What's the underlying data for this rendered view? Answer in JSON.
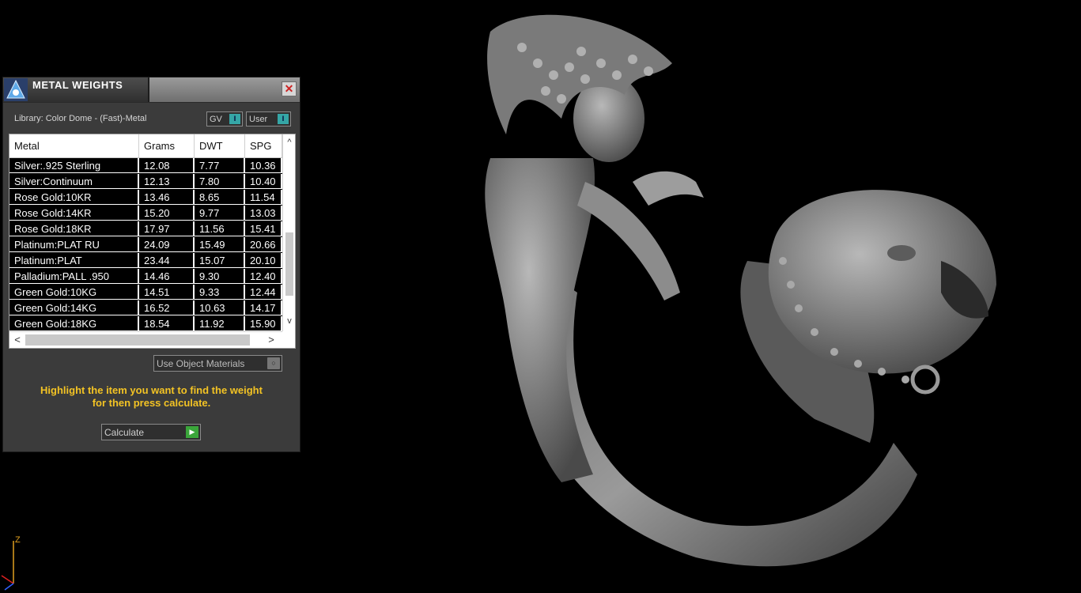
{
  "panel": {
    "title": "METAL WEIGHTS",
    "close_glyph": "✕",
    "library_label": "Library: Color Dome - (Fast)-Metal",
    "toggle_gv": "GV",
    "toggle_user": "User",
    "toggle_indicator": "I",
    "use_object_materials": "Use Object Materials",
    "hint_line1": "Highlight the item you want to find the weight",
    "hint_line2": "for then press calculate.",
    "calculate_label": "Calculate"
  },
  "table": {
    "headers": [
      "Metal",
      "Grams",
      "DWT",
      "SPG"
    ],
    "rows": [
      [
        "Silver:.925 Sterling",
        "12.08",
        "7.77",
        "10.36"
      ],
      [
        "Silver:Continuum",
        "12.13",
        "7.80",
        "10.40"
      ],
      [
        "Rose Gold:10KR",
        "13.46",
        "8.65",
        "11.54"
      ],
      [
        "Rose Gold:14KR",
        "15.20",
        "9.77",
        "13.03"
      ],
      [
        "Rose Gold:18KR",
        "17.97",
        "11.56",
        "15.41"
      ],
      [
        "Platinum:PLAT RU",
        "24.09",
        "15.49",
        "20.66"
      ],
      [
        "Platinum:PLAT",
        "23.44",
        "15.07",
        "20.10"
      ],
      [
        "Palladium:PALL .950",
        "14.46",
        "9.30",
        "12.40"
      ],
      [
        "Green Gold:10KG",
        "14.51",
        "9.33",
        "12.44"
      ],
      [
        "Green Gold:14KG",
        "16.52",
        "10.63",
        "14.17"
      ],
      [
        "Green Gold:18KG",
        "18.54",
        "11.92",
        "15.90"
      ]
    ],
    "scroll_up": "^",
    "scroll_down": "v",
    "scroll_left": "<",
    "scroll_right": ">"
  },
  "axis": {
    "z_label": "Z"
  },
  "colors": {
    "hint": "#f3c324",
    "toggle_on": "#35a6a6",
    "calc_go": "#3aa63a"
  }
}
